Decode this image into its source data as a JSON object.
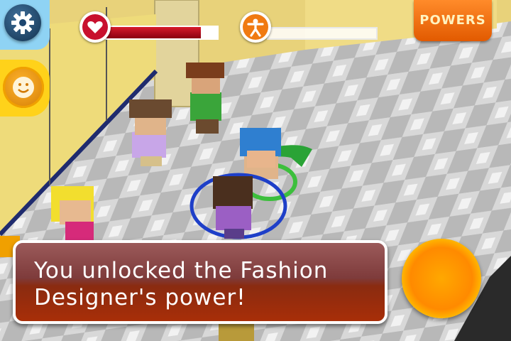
{
  "hud": {
    "settings_icon": "gear-icon",
    "emote_icon": "smiley-icon",
    "health": {
      "icon": "heart-icon",
      "level_fraction": 0.85,
      "color": "#c8102e"
    },
    "energy": {
      "icon": "person-icon",
      "level_fraction": 0.0,
      "color": "#f07a12"
    },
    "powers_label": "POWERS"
  },
  "message": {
    "text": "You unlocked the Fashion Designer's power!"
  },
  "action_button": {
    "color": "#ff9a00"
  }
}
